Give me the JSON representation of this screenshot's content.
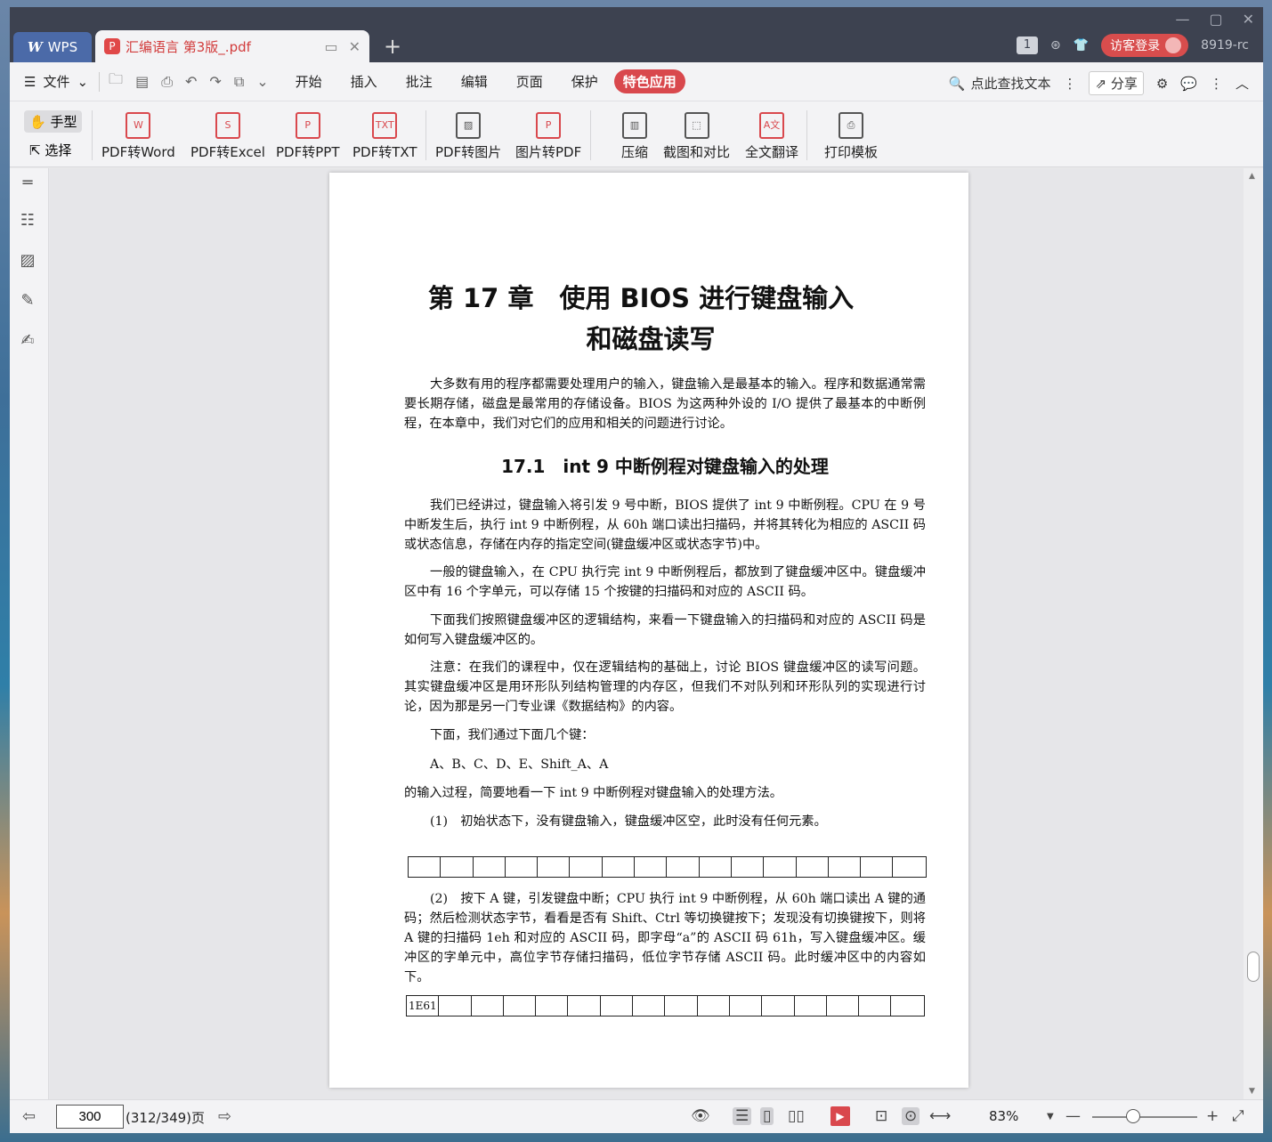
{
  "titlebar": {
    "app_tab": "WPS",
    "doc_tab_title": "汇编语言 第3版_.pdf",
    "counter": "1",
    "visitor_login": "访客登录",
    "user_id": "8919-rc"
  },
  "menu": {
    "file": "文件",
    "tabs": [
      "开始",
      "插入",
      "批注",
      "编辑",
      "页面",
      "保护"
    ],
    "special_app": "特色应用",
    "search_placeholder": "点此查找文本",
    "share": "分享"
  },
  "ribbon": {
    "hand": "手型",
    "select": "选择",
    "buttons": [
      "PDF转Word",
      "PDF转Excel",
      "PDF转PPT",
      "PDF转TXT",
      "PDF转图片",
      "图片转PDF",
      "压缩",
      "截图和对比",
      "全文翻译",
      "打印模板"
    ]
  },
  "document": {
    "chapter_line1": "第 17 章　使用 BIOS 进行键盘输入",
    "chapter_line2": "和磁盘读写",
    "intro": "大多数有用的程序都需要处理用户的输入，键盘输入是最基本的输入。程序和数据通常需要长期存储，磁盘是最常用的存储设备。BIOS 为这两种外设的 I/O 提供了最基本的中断例程，在本章中，我们对它们的应用和相关的问题进行讨论。",
    "section_title": "17.1　int 9 中断例程对键盘输入的处理",
    "p1": "我们已经讲过，键盘输入将引发 9 号中断，BIOS 提供了 int 9 中断例程。CPU 在 9 号中断发生后，执行 int 9 中断例程，从 60h 端口读出扫描码，并将其转化为相应的 ASCII 码或状态信息，存储在内存的指定空间(键盘缓冲区或状态字节)中。",
    "p2": "一般的键盘输入，在 CPU 执行完 int 9 中断例程后，都放到了键盘缓冲区中。键盘缓冲区中有 16 个字单元，可以存储 15 个按键的扫描码和对应的 ASCII 码。",
    "p3": "下面我们按照键盘缓冲区的逻辑结构，来看一下键盘输入的扫描码和对应的 ASCII 码是如何写入键盘缓冲区的。",
    "p4": "注意：在我们的课程中，仅在逻辑结构的基础上，讨论 BIOS 键盘缓冲区的读写问题。其实键盘缓冲区是用环形队列结构管理的内存区，但我们不对队列和环形队列的实现进行讨论，因为那是另一门专业课《数据结构》的内容。",
    "p5": "下面，我们通过下面几个键：",
    "p6": "A、B、C、D、E、Shift_A、A",
    "p7": "的输入过程，简要地看一下 int 9 中断例程对键盘输入的处理方法。",
    "p8": "(1)　初始状态下，没有键盘输入，键盘缓冲区空，此时没有任何元素。",
    "p9": "(2)　按下 A 键，引发键盘中断；CPU 执行 int 9 中断例程，从 60h 端口读出 A 键的通码；然后检测状态字节，看看是否有 Shift、Ctrl 等切换键按下；发现没有切换键按下，则将 A 键的扫描码 1eh 和对应的 ASCII 码，即字母“a”的 ASCII 码 61h，写入键盘缓冲区。缓冲区的字单元中，高位字节存储扫描码，低位字节存储 ASCII 码。此时缓冲区中的内容如下。",
    "buffer2_first": "1E61"
  },
  "statusbar": {
    "page_input": "300",
    "page_count": "(312/349)页",
    "zoom": "83%"
  },
  "colors": {
    "accent": "#d9484d",
    "titlebar": "#3d4250",
    "wps_tab": "#4b6aa8"
  }
}
